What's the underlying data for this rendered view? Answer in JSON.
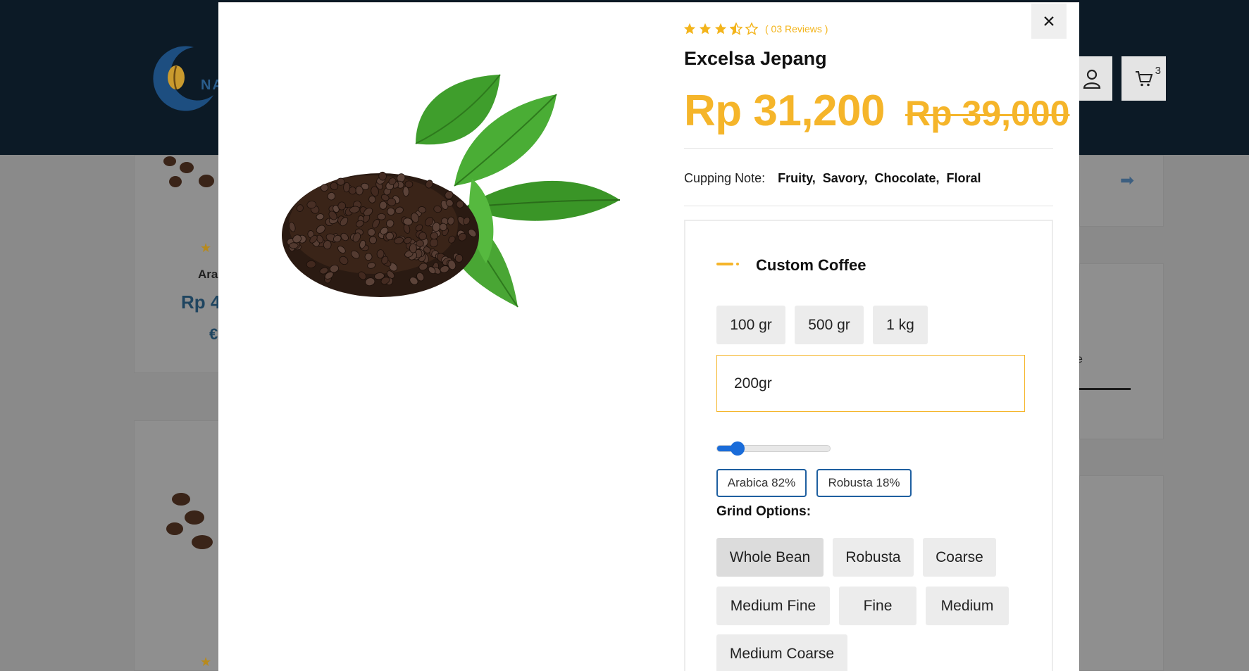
{
  "background": {
    "logo_text": "NA",
    "cart_count": "3",
    "card_name": "Ara",
    "card_price": "Rp 4",
    "card_icon": "€",
    "right_text": "e"
  },
  "modal": {
    "rating": {
      "value": 3.5,
      "max": 5,
      "reviews_label": "( 03 Reviews )"
    },
    "product_title": "Excelsa Jepang",
    "price_current": "Rp 31,200",
    "price_old": "Rp 39,000",
    "cupping": {
      "label": "Cupping Note:",
      "notes": [
        "Fruity,",
        "Savory,",
        "Chocolate,",
        "Floral"
      ]
    },
    "custom": {
      "title": "Custom Coffee",
      "weight_options": [
        "100 gr",
        "500 gr",
        "1 kg"
      ],
      "weight_input_value": "200gr",
      "blend_slider_value": 0.18,
      "blend_labels": [
        "Arabica 82%",
        "Robusta 18%"
      ],
      "grind_label": "Grind Options:",
      "grind_options": [
        "Whole Bean",
        "Robusta",
        "Coarse",
        "Medium Fine",
        "Fine",
        "Medium",
        "Medium Coarse"
      ],
      "selected_grind": "Whole Bean"
    }
  },
  "colors": {
    "accent": "#f5b52a",
    "slider": "#1a6cd9",
    "blend_border": "#1e5fa0",
    "header_bg": "#0c1a26"
  }
}
